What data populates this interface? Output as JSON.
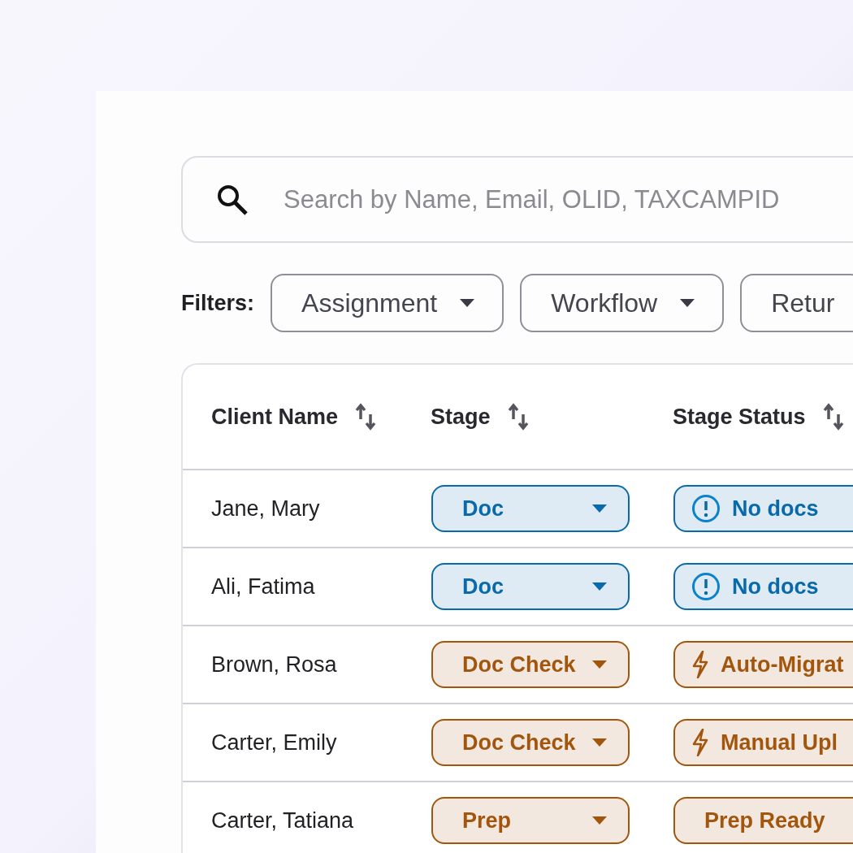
{
  "search": {
    "placeholder": "Search by Name, Email, OLID, TAXCAMPID"
  },
  "filters": {
    "label": "Filters:",
    "items": [
      "Assignment",
      "Workflow",
      "Retur"
    ]
  },
  "table": {
    "columns": [
      "Client Name",
      "Stage",
      "Stage Status"
    ],
    "rows": [
      {
        "client": "Jane, Mary",
        "stage": {
          "label": "Doc",
          "color": "#0a69ab"
        },
        "status": {
          "label": "No docs",
          "kind": "alert",
          "color": "#0a69ab"
        }
      },
      {
        "client": "Ali, Fatima",
        "stage": {
          "label": "Doc",
          "color": "#0a69ab"
        },
        "status": {
          "label": "No docs",
          "kind": "alert",
          "color": "#0a69ab"
        }
      },
      {
        "client": "Brown, Rosa",
        "stage": {
          "label": "Doc Check",
          "color": "#a2550d"
        },
        "status": {
          "label": "Auto-Migrat",
          "kind": "bolt",
          "color": "#a2550d"
        }
      },
      {
        "client": "Carter, Emily",
        "stage": {
          "label": "Doc Check",
          "color": "#a2550d"
        },
        "status": {
          "label": "Manual Upl",
          "kind": "bolt",
          "color": "#a2550d"
        }
      },
      {
        "client": "Carter, Tatiana",
        "stage": {
          "label": "Prep",
          "color": "#a2550d"
        },
        "status": {
          "label": "Prep Ready",
          "kind": "plain",
          "color": "#a2550d"
        }
      }
    ]
  }
}
